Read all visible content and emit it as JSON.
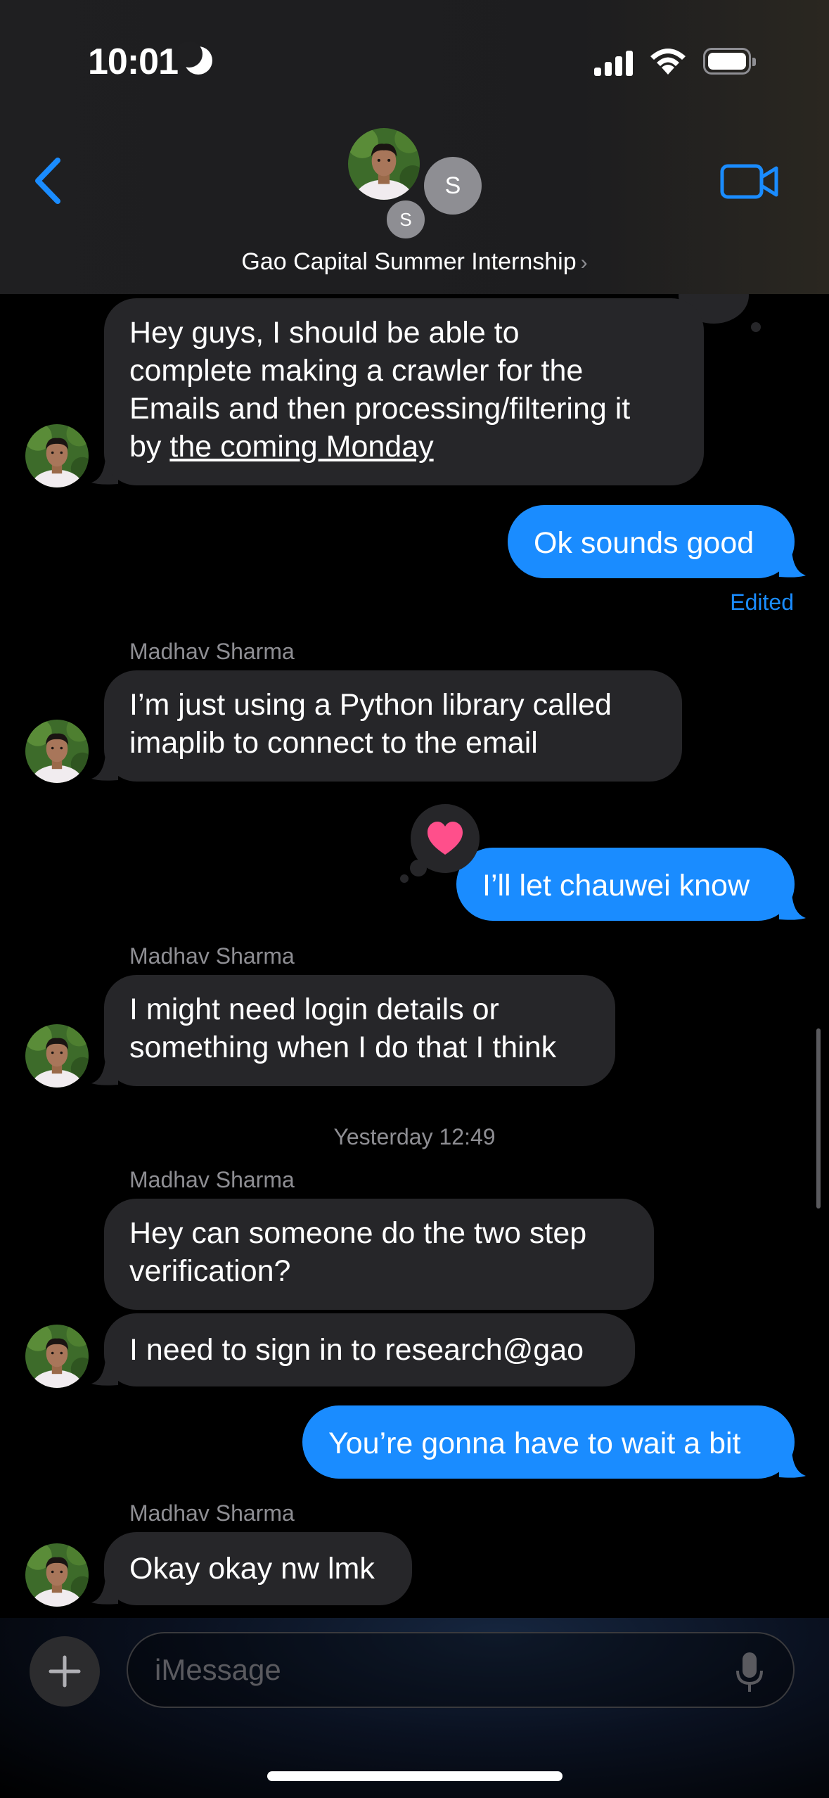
{
  "status_bar": {
    "time": "10:01"
  },
  "header": {
    "group_name": "Gao Capital Summer Internship",
    "avatar_initial_large": "S",
    "avatar_initial_small": "S"
  },
  "messages": {
    "m1": {
      "lines": [
        "Hey guys, I should be able to",
        "complete making a crawler for the",
        "Emails and then processing/filtering it"
      ],
      "line4_prefix": "by ",
      "line4_link": "the coming Monday"
    },
    "m2": {
      "text": "Ok sounds good",
      "edited_label": "Edited"
    },
    "sender_1": "Madhav Sharma",
    "m3": {
      "lines": [
        "I’m just using a Python library called",
        "imaplib to connect to the email"
      ]
    },
    "m4": {
      "text": "I’ll let chauwei know",
      "reaction": "heart"
    },
    "sender_2": "Madhav Sharma",
    "m5": {
      "lines": [
        "I might need login details or",
        "something when I do that I think"
      ]
    },
    "timestamp": "Yesterday 12:49",
    "sender_3": "Madhav Sharma",
    "m6": {
      "lines": [
        "Hey can someone do the two step",
        "verification?"
      ]
    },
    "m7": {
      "text": "I need to sign in to research@gao"
    },
    "m8": {
      "text": "You’re gonna have to wait a bit"
    },
    "sender_4": "Madhav Sharma",
    "m9": {
      "text": "Okay okay nw lmk"
    }
  },
  "input": {
    "placeholder": "iMessage"
  },
  "colors": {
    "outgoing": "#1a8cff",
    "incoming": "#262629",
    "accent": "#1a8cff",
    "reaction_heart": "#ff4f8b"
  }
}
